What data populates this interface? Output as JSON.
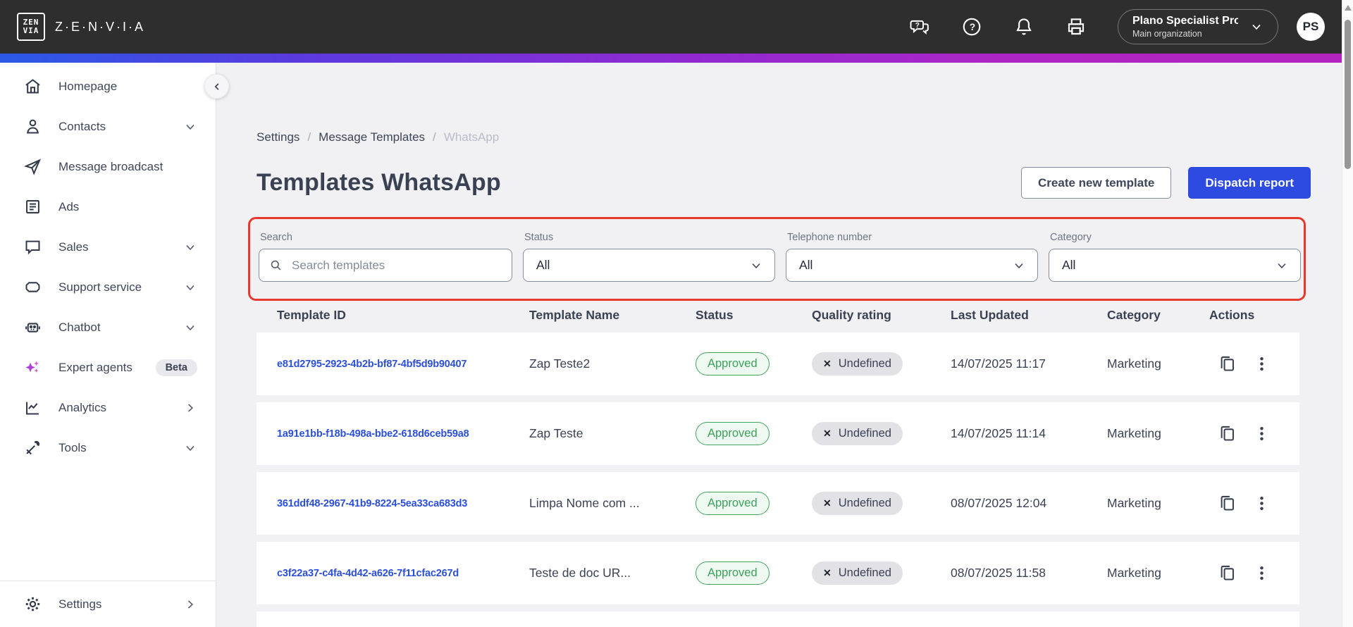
{
  "header": {
    "logo_line1": "ZEN",
    "logo_line2": "VIA",
    "logo_text": "Z·E·N·V·I·A",
    "org_name": "Plano Specialist Pro...",
    "org_subtitle": "Main organization",
    "avatar_initials": "PS"
  },
  "sidebar": {
    "items": [
      {
        "label": "Homepage",
        "icon": "home-icon",
        "chevron": "none"
      },
      {
        "label": "Contacts",
        "icon": "contacts-icon",
        "chevron": "down"
      },
      {
        "label": "Message broadcast",
        "icon": "send-icon",
        "chevron": "none"
      },
      {
        "label": "Ads",
        "icon": "ads-icon",
        "chevron": "none"
      },
      {
        "label": "Sales",
        "icon": "sales-icon",
        "chevron": "down"
      },
      {
        "label": "Support service",
        "icon": "ticket-icon",
        "chevron": "down"
      },
      {
        "label": "Chatbot",
        "icon": "chatbot-icon",
        "chevron": "down"
      },
      {
        "label": "Expert agents",
        "icon": "sparkles-icon",
        "badge": "Beta",
        "chevron": "none"
      },
      {
        "label": "Analytics",
        "icon": "analytics-icon",
        "chevron": "right"
      },
      {
        "label": "Tools",
        "icon": "tools-icon",
        "chevron": "down"
      }
    ],
    "bottom_item": {
      "label": "Settings",
      "icon": "gear-icon",
      "chevron": "right"
    }
  },
  "breadcrumb": [
    "Settings",
    "Message Templates",
    "WhatsApp"
  ],
  "page": {
    "title": "Templates WhatsApp",
    "create_button": "Create new template",
    "dispatch_button": "Dispatch report"
  },
  "filters": {
    "search": {
      "label": "Search",
      "placeholder": "Search templates"
    },
    "status": {
      "label": "Status",
      "value": "All"
    },
    "telephone": {
      "label": "Telephone number",
      "value": "All"
    },
    "category": {
      "label": "Category",
      "value": "All"
    }
  },
  "table": {
    "columns": [
      "Template ID",
      "Template Name",
      "Status",
      "Quality rating",
      "Last Updated",
      "Category",
      "Actions"
    ],
    "rows": [
      {
        "id": "e81d2795-2923-4b2b-bf87-4bf5d9b90407",
        "name": "Zap Teste2",
        "status": "Approved",
        "quality_x": "✕",
        "quality": "Undefined",
        "updated": "14/07/2025 11:17",
        "category": "Marketing"
      },
      {
        "id": "1a91e1bb-f18b-498a-bbe2-618d6ceb59a8",
        "name": "Zap Teste",
        "status": "Approved",
        "quality_x": "✕",
        "quality": "Undefined",
        "updated": "14/07/2025 11:14",
        "category": "Marketing"
      },
      {
        "id": "361ddf48-2967-41b9-8224-5ea33ca683d3",
        "name": "Limpa Nome com ...",
        "status": "Approved",
        "quality_x": "✕",
        "quality": "Undefined",
        "updated": "08/07/2025 12:04",
        "category": "Marketing"
      },
      {
        "id": "c3f22a37-c4fa-4d42-a626-7f11cfac267d",
        "name": "Teste de doc UR...",
        "status": "Approved",
        "quality_x": "✕",
        "quality": "Undefined",
        "updated": "08/07/2025 11:58",
        "category": "Marketing"
      }
    ]
  },
  "colors": {
    "topbar_bg": "#2e2e2e",
    "primary_blue": "#2d4be0",
    "link_blue": "#2b4fd7",
    "approved_green": "#3da15a",
    "annotation_red": "#e63a2e",
    "gradient_start": "#2b59e8",
    "gradient_end": "#b224bd"
  }
}
